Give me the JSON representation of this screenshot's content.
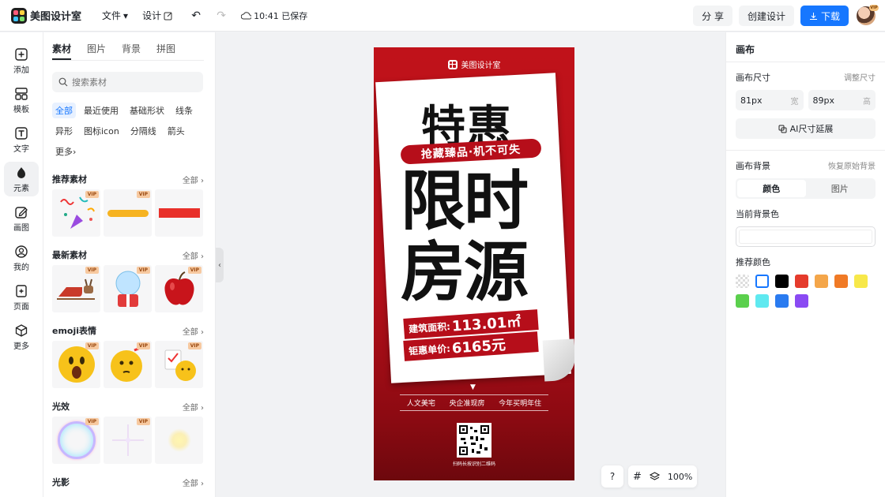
{
  "app": {
    "title": "美图设计室"
  },
  "menu": {
    "file": "文件",
    "design": "设计",
    "saved_time": "10:41 已保存"
  },
  "actions": {
    "share": "分 享",
    "create": "创建设计",
    "download": "下载"
  },
  "rail": [
    {
      "label": "添加",
      "icon": "plus-square-icon"
    },
    {
      "label": "模板",
      "icon": "template-icon"
    },
    {
      "label": "文字",
      "icon": "text-icon"
    },
    {
      "label": "元素",
      "icon": "element-icon",
      "active": true
    },
    {
      "label": "画图",
      "icon": "draw-icon"
    },
    {
      "label": "我的",
      "icon": "user-icon"
    },
    {
      "label": "页面",
      "icon": "page-icon"
    },
    {
      "label": "更多",
      "icon": "more-cube-icon"
    }
  ],
  "panel": {
    "tabs": [
      "素材",
      "图片",
      "背景",
      "拼图"
    ],
    "search_placeholder": "搜索素材",
    "chips": [
      "全部",
      "最近使用",
      "基础形状",
      "线条",
      "异形",
      "图标icon",
      "分隔线",
      "箭头",
      "更多"
    ],
    "all_label": "全部",
    "vip_label": "VIP",
    "sections": [
      {
        "title": "推荐素材"
      },
      {
        "title": "最新素材"
      },
      {
        "title": "emoji表情"
      },
      {
        "title": "光效"
      },
      {
        "title": "光影"
      }
    ]
  },
  "poster": {
    "brand": "美图设计室",
    "headline": "特惠",
    "tagline": "抢藏臻品·机不可失",
    "big_line1": "限时",
    "big_line2": "房源",
    "area_label": "建筑面积:",
    "area_value": "113.01㎡",
    "price_label": "钜惠单价:",
    "price_value": "6165元",
    "tags": [
      "人文美宅",
      "央企准现房",
      "今年买明年住"
    ],
    "qr_caption": "扫码长按识别二维码"
  },
  "zoom": {
    "help": "?",
    "value": "100%"
  },
  "inspector": {
    "title": "画布",
    "size_label": "画布尺寸",
    "resize_label": "调整尺寸",
    "width": "81px",
    "width_unit": "宽",
    "height": "89px",
    "height_unit": "高",
    "ai_extend": "AI尺寸延展",
    "bg_label": "画布背景",
    "restore_bg": "恢复原始背景",
    "seg_color": "颜色",
    "seg_image": "图片",
    "current_bg": "当前背景色",
    "recommend": "推荐颜色",
    "colors": [
      "transparent",
      "#ffffff",
      "#000000",
      "#e53b2c",
      "#f4a64a",
      "#f07a26",
      "#f7e84a",
      "#5bd04d",
      "#5fe9f0",
      "#2a7bf0",
      "#8a4af3"
    ]
  }
}
